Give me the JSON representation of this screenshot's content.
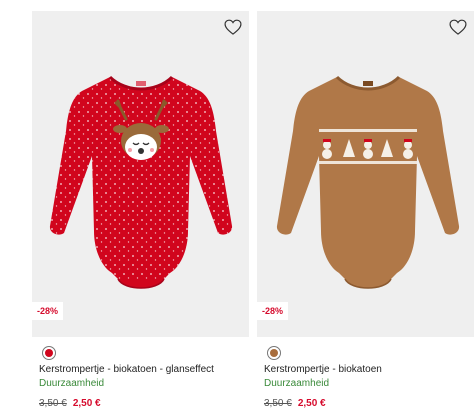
{
  "products": [
    {
      "discount": "-28%",
      "swatch_color": "#d1051d",
      "title": "Kerstrompertje - biokatoen - glanseffect",
      "tag": "Duurzaamheid",
      "old_price": "3,50 €",
      "new_price": "2,50 €",
      "icon": "heart-icon"
    },
    {
      "discount": "-28%",
      "swatch_color": "#a86d3d",
      "title": "Kerstrompertje - biokatoen",
      "tag": "Duurzaamheid",
      "old_price": "3,50 €",
      "new_price": "2,50 €",
      "icon": "heart-icon"
    }
  ],
  "colors": {
    "price_red": "#d60b2d",
    "tag_green": "#3a8a3a"
  }
}
